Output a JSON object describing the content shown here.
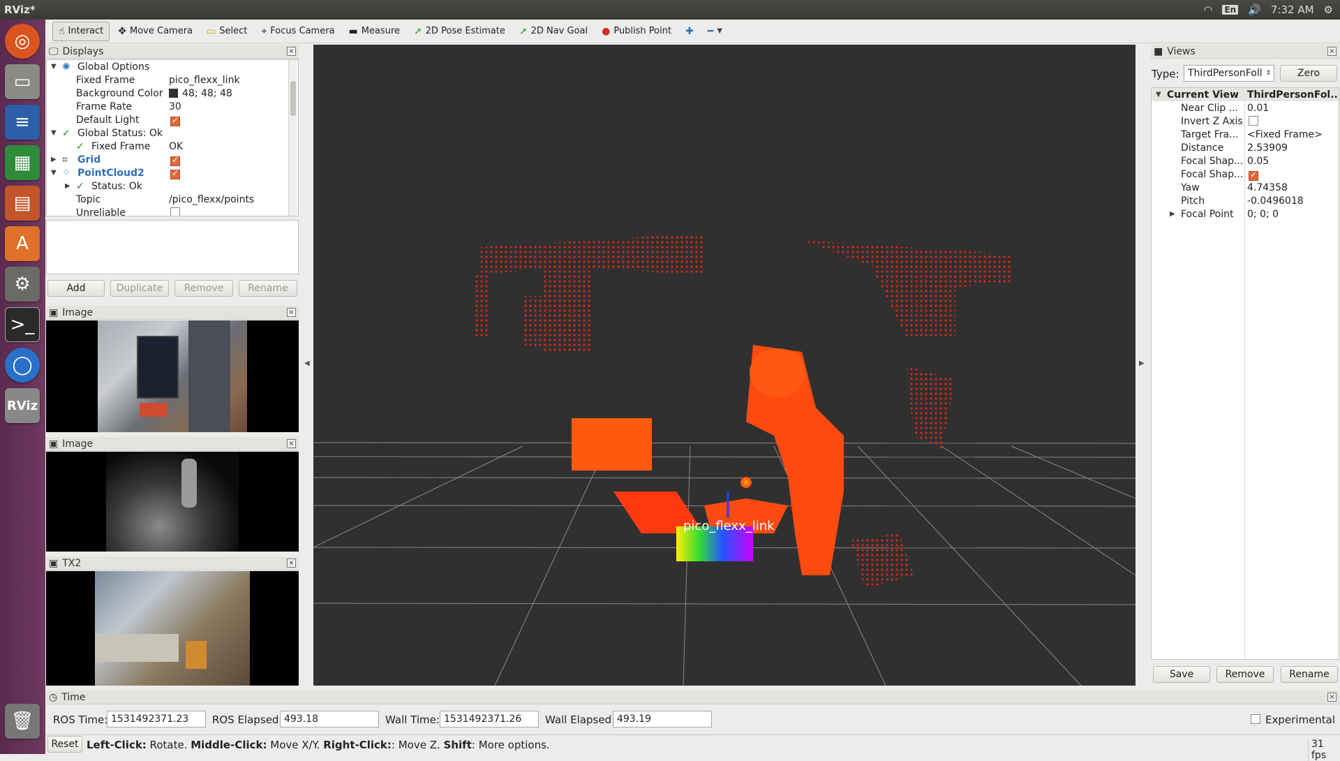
{
  "topbar": {
    "title": "RViz*",
    "lang": "En",
    "time": "7:32 AM"
  },
  "toolbar": [
    {
      "name": "interact",
      "label": "Interact",
      "icon": "hand-icon",
      "active": true
    },
    {
      "name": "move-camera",
      "label": "Move Camera",
      "icon": "move-icon"
    },
    {
      "name": "select",
      "label": "Select",
      "icon": "select-icon"
    },
    {
      "name": "focus-camera",
      "label": "Focus Camera",
      "icon": "crosshair-icon"
    },
    {
      "name": "measure",
      "label": "Measure",
      "icon": "ruler-icon"
    },
    {
      "name": "pose-estimate",
      "label": "2D Pose Estimate",
      "icon": "green-arrow-icon"
    },
    {
      "name": "nav-goal",
      "label": "2D Nav Goal",
      "icon": "green-arrow-icon"
    },
    {
      "name": "publish-point",
      "label": "Publish Point",
      "icon": "pin-icon"
    }
  ],
  "displays": {
    "title": "Displays",
    "rows": [
      {
        "label": "Global Options",
        "value": ""
      },
      {
        "label": "Fixed Frame",
        "value": "pico_flexx_link"
      },
      {
        "label": "Background Color",
        "value": "48; 48; 48"
      },
      {
        "label": "Frame Rate",
        "value": "30"
      },
      {
        "label": "Default Light",
        "value": ""
      },
      {
        "label": "Global Status: Ok",
        "value": ""
      },
      {
        "label": "Fixed Frame",
        "value": "OK"
      },
      {
        "label": "Grid",
        "value": ""
      },
      {
        "label": "PointCloud2",
        "value": ""
      },
      {
        "label": "Status: Ok",
        "value": ""
      },
      {
        "label": "Topic",
        "value": "/pico_flexx/points"
      },
      {
        "label": "Unreliable",
        "value": ""
      }
    ],
    "buttons": {
      "add": "Add",
      "duplicate": "Duplicate",
      "remove": "Remove",
      "rename": "Rename"
    }
  },
  "image_panels": [
    {
      "title": "Image"
    },
    {
      "title": "Image"
    },
    {
      "title": "TX2"
    }
  ],
  "viewport": {
    "frame_label": "pico_flexx_link"
  },
  "views": {
    "title": "Views",
    "type_label": "Type:",
    "type_value": "ThirdPersonFoll",
    "zero": "Zero",
    "header": {
      "label": "Current View",
      "value": "ThirdPersonFol..."
    },
    "rows": [
      {
        "label": "Near Clip ...",
        "value": "0.01"
      },
      {
        "label": "Invert Z Axis",
        "value": ""
      },
      {
        "label": "Target Fra...",
        "value": "<Fixed Frame>"
      },
      {
        "label": "Distance",
        "value": "2.53909"
      },
      {
        "label": "Focal Shap...",
        "value": "0.05"
      },
      {
        "label": "Focal Shap...",
        "value": ""
      },
      {
        "label": "Yaw",
        "value": "4.74358"
      },
      {
        "label": "Pitch",
        "value": "-0.0496018"
      },
      {
        "label": "Focal Point",
        "value": "0; 0; 0"
      }
    ],
    "buttons": {
      "save": "Save",
      "remove": "Remove",
      "rename": "Rename"
    }
  },
  "time": {
    "title": "Time",
    "ros_time_label": "ROS Time:",
    "ros_time": "1531492371.23",
    "ros_elapsed_label": "ROS Elapsed:",
    "ros_elapsed": "493.18",
    "wall_time_label": "Wall Time:",
    "wall_time": "1531492371.26",
    "wall_elapsed_label": "Wall Elapsed:",
    "wall_elapsed": "493.19",
    "experimental": "Experimental"
  },
  "status": {
    "reset": "Reset",
    "k1": "Left-Click:",
    "v1": " Rotate. ",
    "k2": "Middle-Click:",
    "v2": " Move X/Y. ",
    "k3": "Right-Click:",
    "v3": ": Move Z. ",
    "k4": "Shift",
    "v4": ": More options.",
    "fps": "31 fps"
  }
}
